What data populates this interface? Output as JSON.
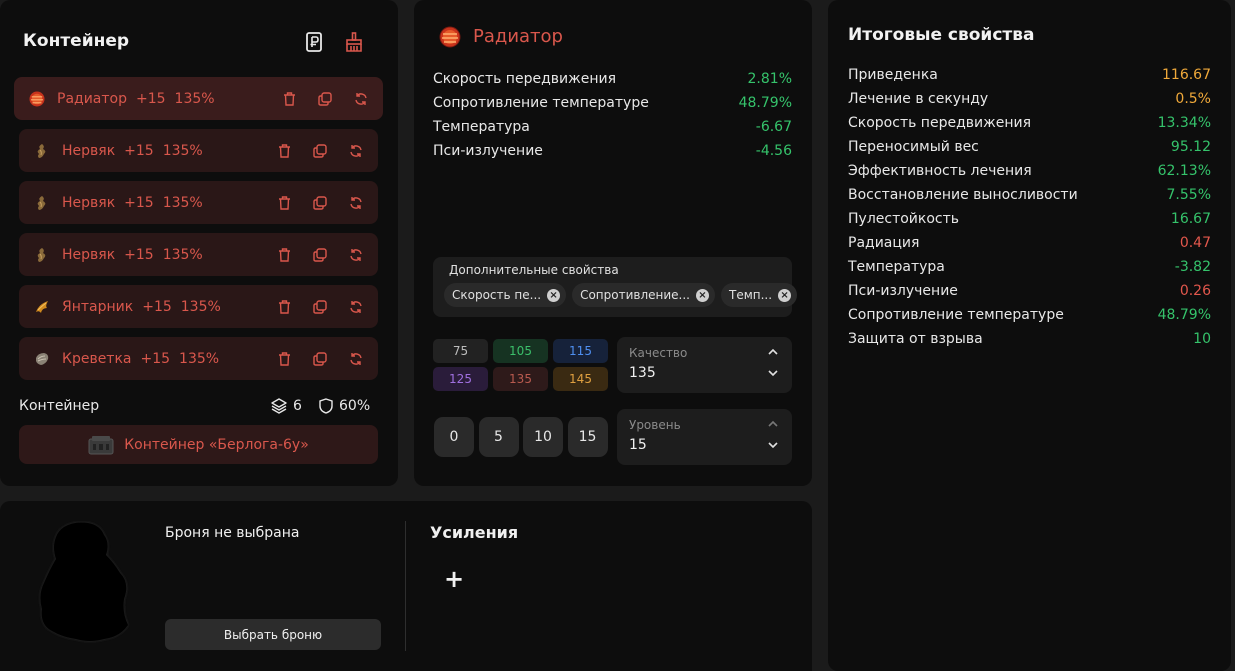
{
  "container": {
    "title": "Контейнер",
    "items": [
      {
        "name": "Радиатор",
        "level": "+15",
        "quality": "135%",
        "icon": "radiator-icon"
      },
      {
        "name": "Нервяк",
        "level": "+15",
        "quality": "135%",
        "icon": "nervyak-icon"
      },
      {
        "name": "Нервяк",
        "level": "+15",
        "quality": "135%",
        "icon": "nervyak-icon"
      },
      {
        "name": "Нервяк",
        "level": "+15",
        "quality": "135%",
        "icon": "nervyak-icon"
      },
      {
        "name": "Янтарник",
        "level": "+15",
        "quality": "135%",
        "icon": "yantarnik-icon"
      },
      {
        "name": "Креветка",
        "level": "+15",
        "quality": "135%",
        "icon": "krevetka-icon"
      }
    ],
    "footer_label": "Контейнер",
    "slots": "6",
    "protection": "60%",
    "container_name": "Контейнер «Берлога-6у»"
  },
  "detail": {
    "title": "Радиатор",
    "stats": [
      {
        "name": "Скорость передвижения",
        "value": "2.81%",
        "color": "green"
      },
      {
        "name": "Сопротивление температуре",
        "value": "48.79%",
        "color": "green"
      },
      {
        "name": "Температура",
        "value": "-6.67",
        "color": "green"
      },
      {
        "name": "Пси-излучение",
        "value": "-4.56",
        "color": "green"
      }
    ],
    "extra_title": "Дополнительные свойства",
    "chips": [
      "Скорость пе...",
      "Сопротивление...",
      "Темп..."
    ],
    "quality_options": [
      "75",
      "105",
      "115",
      "125",
      "135",
      "145"
    ],
    "quality_label": "Качество",
    "quality_value": "135",
    "level_options": [
      "0",
      "5",
      "10",
      "15"
    ],
    "level_label": "Уровень",
    "level_value": "15"
  },
  "totals": {
    "title": "Итоговые свойства",
    "stats": [
      {
        "name": "Приведенка",
        "value": "116.67",
        "color": "orange"
      },
      {
        "name": "Лечение в секунду",
        "value": "0.5%",
        "color": "orange"
      },
      {
        "name": "Скорость передвижения",
        "value": "13.34%",
        "color": "green"
      },
      {
        "name": "Переносимый вес",
        "value": "95.12",
        "color": "green"
      },
      {
        "name": "Эффективность лечения",
        "value": "62.13%",
        "color": "green"
      },
      {
        "name": "Восстановление выносливости",
        "value": "7.55%",
        "color": "green"
      },
      {
        "name": "Пулестойкость",
        "value": "16.67",
        "color": "green"
      },
      {
        "name": "Радиация",
        "value": "0.47",
        "color": "red"
      },
      {
        "name": "Температура",
        "value": "-3.82",
        "color": "green"
      },
      {
        "name": "Пси-излучение",
        "value": "0.26",
        "color": "red"
      },
      {
        "name": "Сопротивление температуре",
        "value": "48.79%",
        "color": "green"
      },
      {
        "name": "Защита от взрыва",
        "value": "10",
        "color": "green"
      }
    ]
  },
  "armor": {
    "no_armor": "Броня не выбрана",
    "select_button": "Выбрать броню",
    "boosts_title": "Усиления",
    "add_symbol": "+"
  },
  "colors": {
    "accent": "#d9574c",
    "green": "#35c36b",
    "orange": "#f0a93a",
    "red": "#e2574c"
  }
}
